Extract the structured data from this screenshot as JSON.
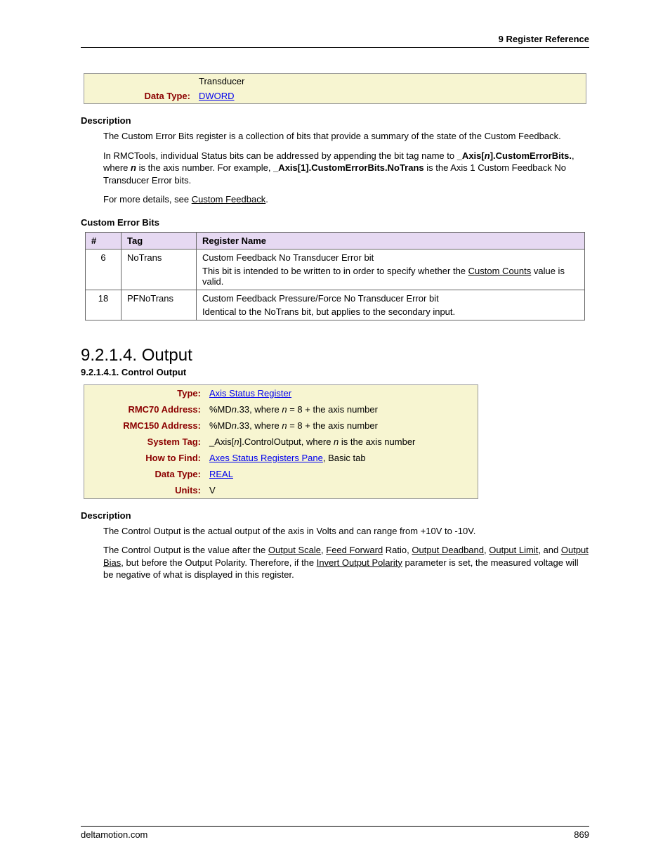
{
  "header": {
    "chapter": "9  Register Reference"
  },
  "topbox": {
    "prev_value": "Transducer",
    "data_type_label": "Data Type:",
    "data_type_link": "DWORD"
  },
  "desc1": {
    "title": "Description",
    "p1": "The Custom Error Bits register is a collection of bits that provide a summary of the state of the Custom Feedback.",
    "p2a": "In RMCTools, individual Status bits can be addressed by appending the bit tag name to ",
    "p2b": "_Axis[",
    "p2c": "n",
    "p2d": "].CustomErrorBits.",
    "p2e": ", where ",
    "p2f": "n",
    "p2g": " is the axis number. For example, ",
    "p2h": "_Axis[1].CustomErrorBits.NoTrans",
    "p2i": " is the Axis 1 Custom Feedback No Transducer Error bits.",
    "p3a": "For more details, see ",
    "p3link": "Custom Feedback",
    "p3b": "."
  },
  "bits": {
    "title": "Custom Error Bits",
    "headers": {
      "num": "#",
      "tag": "Tag",
      "reg": "Register Name"
    },
    "rows": [
      {
        "num": "6",
        "tag": "NoTrans",
        "name": "Custom Feedback No Transducer Error bit",
        "desc_a": "This bit is intended to be written to in order to specify whether the ",
        "desc_link": "Custom Counts",
        "desc_b": " value is valid."
      },
      {
        "num": "18",
        "tag": "PFNoTrans",
        "name": "Custom Feedback Pressure/Force No Transducer Error bit",
        "desc": "Identical to the NoTrans bit, but applies to the secondary input."
      }
    ]
  },
  "output": {
    "heading": "9.2.1.4. Output",
    "subheading": "9.2.1.4.1. Control Output",
    "rows": {
      "type_label": "Type:",
      "type_link": "Axis Status Register",
      "rmc70_label": "RMC70 Address:",
      "rmc70_a": "%MD",
      "rmc70_n": "n",
      "rmc70_b": ".33, where ",
      "rmc70_c": "n",
      "rmc70_d": " = 8 + the axis number",
      "rmc150_label": "RMC150 Address:",
      "systag_label": "System Tag:",
      "systag_a": "_Axis[",
      "systag_n": "n",
      "systag_b": "].ControlOutput, where ",
      "systag_c": "n",
      "systag_d": " is the axis number",
      "find_label": "How to Find:",
      "find_link": "Axes Status Registers Pane",
      "find_rest": ", Basic tab",
      "dt_label": "Data Type:",
      "dt_link": "REAL",
      "units_label": "Units:",
      "units_val": "V"
    }
  },
  "desc2": {
    "title": "Description",
    "p1": "The Control Output is the actual output of the axis in Volts and can range from +10V to -10V.",
    "p2a": "The Control Output is the value after the ",
    "l1": "Output Scale",
    "p2b": ", ",
    "l2": "Feed Forward",
    "p2c": " Ratio, ",
    "l3": "Output Deadband",
    "p2d": ", ",
    "l4": "Output Limit",
    "p2e": ", and ",
    "l5": "Output Bias",
    "p2f": ", but before the Output Polarity. Therefore, if the ",
    "l6": "Invert Output Polarity",
    "p2g": " parameter is set, the measured voltage will be negative of what is displayed in this register."
  },
  "footer": {
    "site": "deltamotion.com",
    "page": "869"
  }
}
